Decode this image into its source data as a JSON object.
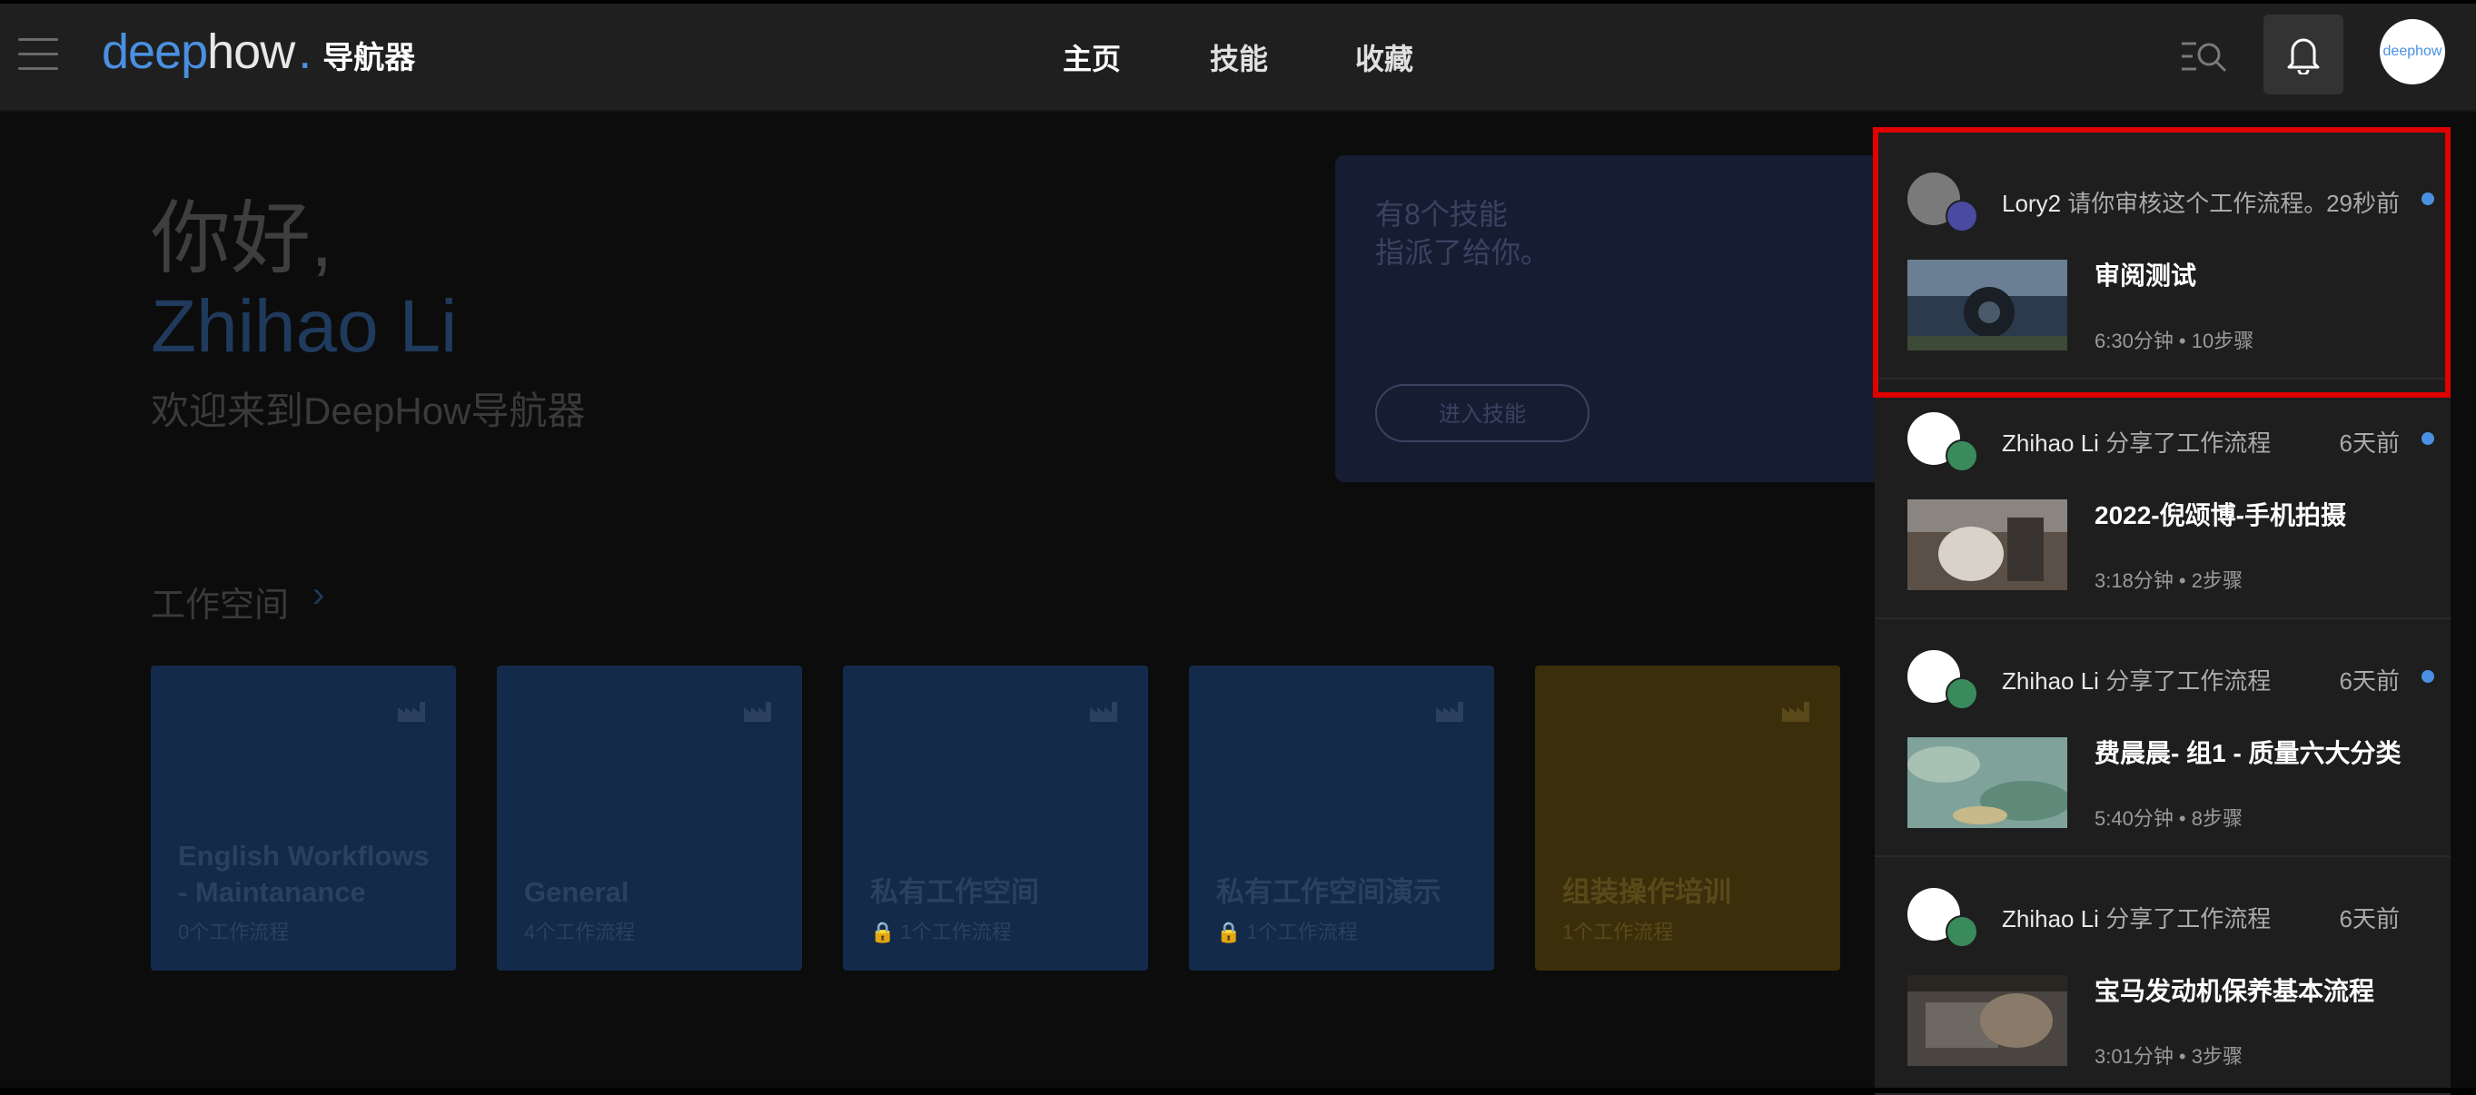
{
  "header": {
    "logo": {
      "deep": "deep",
      "how": "how",
      "dot": ".",
      "sub": "导航器"
    },
    "nav": [
      "主页",
      "技能",
      "收藏"
    ],
    "avatar_text": "deephow"
  },
  "hero": {
    "greeting": "你好,",
    "name": "Zhihao Li",
    "welcome": "欢迎来到DeepHow导航器"
  },
  "assign": {
    "line1": "有8个技能",
    "line2": "指派了给你。",
    "button": "进入技能"
  },
  "workspaces": {
    "title": "工作空间",
    "cards": [
      {
        "title_l1": "English Workflows",
        "title_l2": "- Maintanance",
        "count": "0个工作流程"
      },
      {
        "title_l1": "General",
        "title_l2": "",
        "count": "4个工作流程"
      },
      {
        "title_l1": "私有工作空间",
        "title_l2": "",
        "count": "1个工作流程"
      },
      {
        "title_l1": "私有工作空间演示",
        "title_l2": "",
        "count": "1个工作流程"
      },
      {
        "title_l1": "组装操作培训",
        "title_l2": "",
        "count": "1个工作流程"
      }
    ]
  },
  "notifications": [
    {
      "user": "Lory2",
      "action": "请你审核这个工作流程。",
      "time": "29秒前",
      "title": "审阅测试",
      "meta": "6:30分钟 • 10步骤",
      "unread": true
    },
    {
      "user": "Zhihao Li",
      "action": "分享了工作流程",
      "time": "6天前",
      "title": "2022-倪颂博-手机拍摄",
      "meta": "3:18分钟 • 2步骤",
      "unread": true
    },
    {
      "user": "Zhihao Li",
      "action": "分享了工作流程",
      "time": "6天前",
      "title": "费晨晨- 组1 - 质量六大分类",
      "meta": "5:40分钟 • 8步骤",
      "unread": true
    },
    {
      "user": "Zhihao Li",
      "action": "分享了工作流程",
      "time": "6天前",
      "title": "宝马发动机保养基本流程",
      "meta": "3:01分钟 • 3步骤",
      "unread": false
    }
  ]
}
